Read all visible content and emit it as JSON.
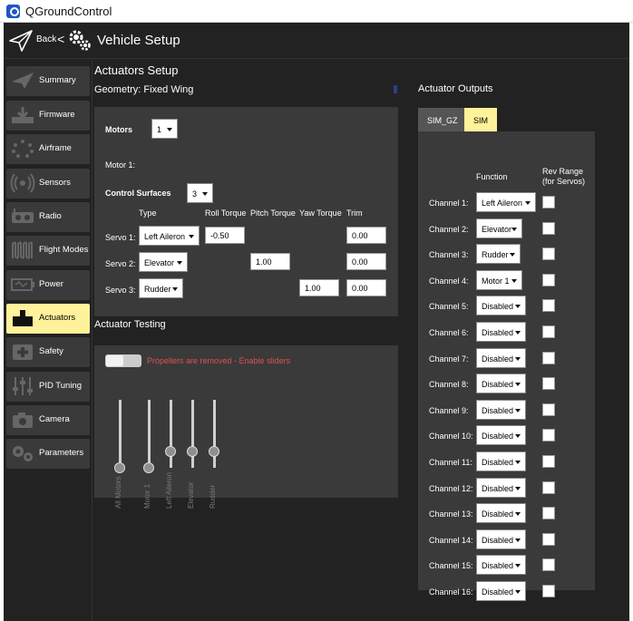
{
  "app": {
    "title": "QGroundControl"
  },
  "topbar": {
    "back_label": "Back",
    "back_chevron": "<",
    "page_title": "Vehicle Setup"
  },
  "sidebar": {
    "items": [
      {
        "label": "Summary",
        "icon": "paper-plane-icon"
      },
      {
        "label": "Firmware",
        "icon": "download-icon"
      },
      {
        "label": "Airframe",
        "icon": "airframe-dots-icon"
      },
      {
        "label": "Sensors",
        "icon": "sensor-waves-icon"
      },
      {
        "label": "Radio",
        "icon": "radio-icon"
      },
      {
        "label": "Flight Modes",
        "icon": "flight-modes-icon"
      },
      {
        "label": "Power",
        "icon": "battery-icon"
      },
      {
        "label": "Actuators",
        "icon": "actuator-icon"
      },
      {
        "label": "Safety",
        "icon": "safety-plus-icon"
      },
      {
        "label": "PID Tuning",
        "icon": "tuning-sliders-icon"
      },
      {
        "label": "Camera",
        "icon": "camera-icon"
      },
      {
        "label": "Parameters",
        "icon": "gears-icon"
      }
    ],
    "active": "Actuators"
  },
  "setup": {
    "title": "Actuators Setup",
    "geometry_title": "Geometry: Fixed Wing",
    "motors_label": "Motors",
    "motors_value": "1",
    "motor1_label": "Motor 1:",
    "control_surfaces_label": "Control Surfaces",
    "control_surfaces_value": "3",
    "headers": {
      "type": "Type",
      "roll": "Roll Torque",
      "pitch": "Pitch Torque",
      "yaw": "Yaw Torque",
      "trim": "Trim"
    },
    "servos": [
      {
        "label": "Servo 1:",
        "type": "Left Aileron",
        "roll": "-0.50",
        "pitch": "",
        "yaw": "",
        "trim": "0.00"
      },
      {
        "label": "Servo 2:",
        "type": "Elevator",
        "roll": "",
        "pitch": "1.00",
        "yaw": "",
        "trim": "0.00"
      },
      {
        "label": "Servo 3:",
        "type": "Rudder",
        "roll": "",
        "pitch": "",
        "yaw": "1.00",
        "trim": "0.00"
      }
    ]
  },
  "testing": {
    "title": "Actuator Testing",
    "warning": "Propellers are removed - Enable sliders",
    "sliders": [
      {
        "label": "All Motors",
        "level": 0
      },
      {
        "label": "Motor 1",
        "level": 0
      },
      {
        "label": "Left Aileron",
        "level": 0.5
      },
      {
        "label": "Elevator",
        "level": 0.5
      },
      {
        "label": "Rudder",
        "level": 0.5
      }
    ]
  },
  "outputs": {
    "title": "Actuator Outputs",
    "tabs": [
      "SIM_GZ",
      "SIM"
    ],
    "active_tab": "SIM",
    "col_function": "Function",
    "col_rev_range": "Rev Range",
    "col_rev_range_sub": "(for Servos)",
    "channels": [
      {
        "label": "Channel 1:",
        "function": "Left Aileron"
      },
      {
        "label": "Channel 2:",
        "function": "Elevator"
      },
      {
        "label": "Channel 3:",
        "function": "Rudder"
      },
      {
        "label": "Channel 4:",
        "function": "Motor 1"
      },
      {
        "label": "Channel 5:",
        "function": "Disabled"
      },
      {
        "label": "Channel 6:",
        "function": "Disabled"
      },
      {
        "label": "Channel 7:",
        "function": "Disabled"
      },
      {
        "label": "Channel 8:",
        "function": "Disabled"
      },
      {
        "label": "Channel 9:",
        "function": "Disabled"
      },
      {
        "label": "Channel 10:",
        "function": "Disabled"
      },
      {
        "label": "Channel 11:",
        "function": "Disabled"
      },
      {
        "label": "Channel 12:",
        "function": "Disabled"
      },
      {
        "label": "Channel 13:",
        "function": "Disabled"
      },
      {
        "label": "Channel 14:",
        "function": "Disabled"
      },
      {
        "label": "Channel 15:",
        "function": "Disabled"
      },
      {
        "label": "Channel 16:",
        "function": "Disabled"
      }
    ]
  },
  "colors": {
    "background": "#222222",
    "panel": "#3a3a3a",
    "sidebar_item": "#3a3a3a",
    "active": "#fff29a",
    "warning": "#e05050"
  }
}
